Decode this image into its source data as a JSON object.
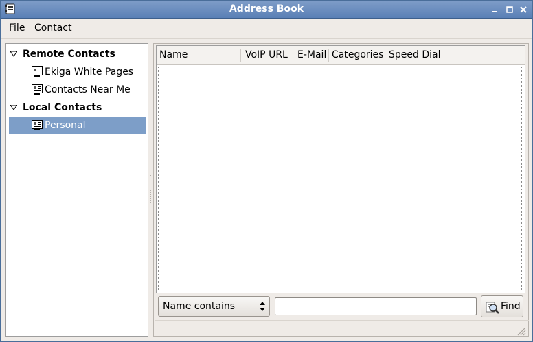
{
  "window": {
    "title": "Address Book"
  },
  "menubar": {
    "file": {
      "mnemonic": "F",
      "rest": "ile"
    },
    "contact": {
      "mnemonic": "C",
      "rest": "ontact"
    }
  },
  "tree": {
    "groups": [
      {
        "label": "Remote Contacts",
        "expanded": true,
        "items": [
          {
            "label": "Ekiga White Pages",
            "icon": "address-book-icon"
          },
          {
            "label": "Contacts Near Me",
            "icon": "address-book-icon"
          }
        ]
      },
      {
        "label": "Local Contacts",
        "expanded": true,
        "items": [
          {
            "label": "Personal",
            "icon": "address-book-icon",
            "selected": true
          }
        ]
      }
    ]
  },
  "contacts_list": {
    "columns": [
      "Name",
      "VoIP URL",
      "E-Mail",
      "Categories",
      "Speed Dial"
    ],
    "rows": []
  },
  "search": {
    "filter_selected": "Name contains",
    "input_value": "",
    "find_button": {
      "mnemonic": "F",
      "rest": "ind"
    }
  },
  "colors": {
    "titlebar": "#5a80b6",
    "selection": "#7d9ec8",
    "window_bg": "#efebe7"
  }
}
